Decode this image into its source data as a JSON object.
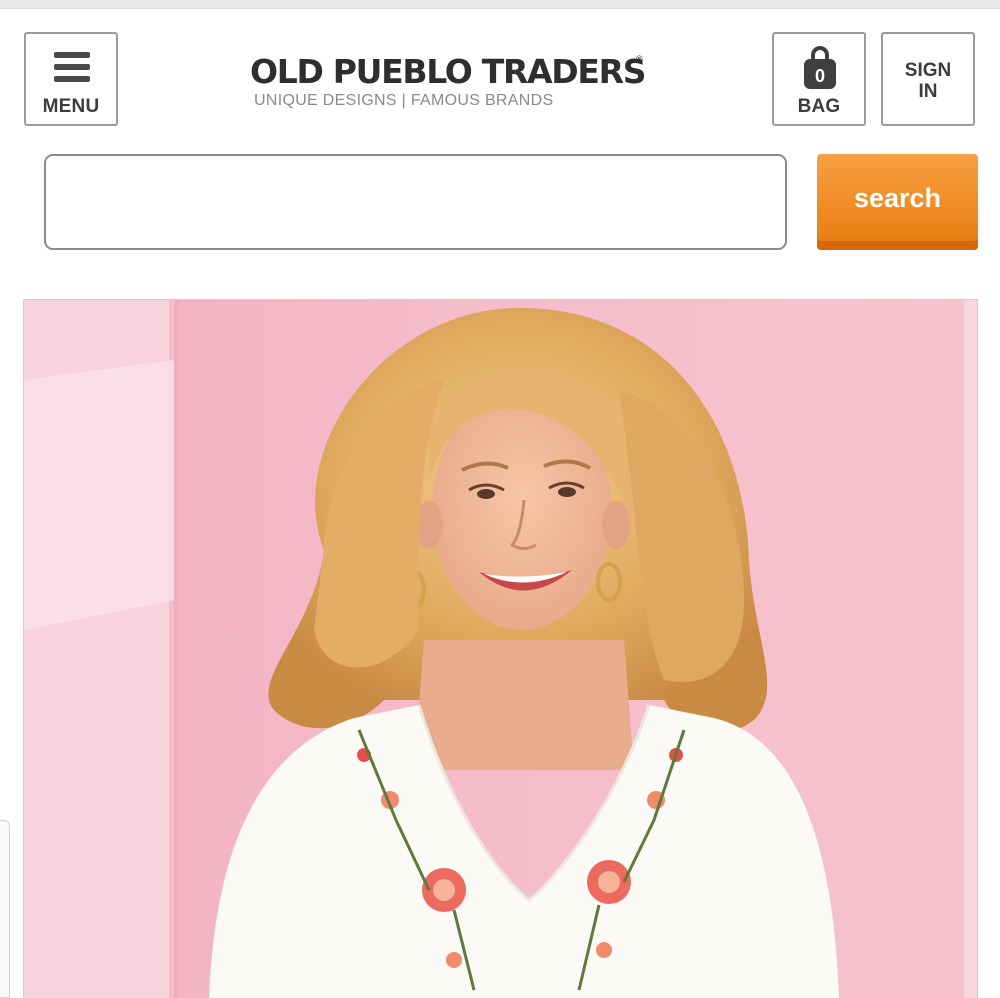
{
  "header": {
    "menu_label": "MENU",
    "bag_label": "BAG",
    "bag_count": "0",
    "signin_line1": "SIGN",
    "signin_line2": "IN",
    "logo_title": "OLD PUEBLO TRADERS",
    "logo_reg": "®",
    "logo_tagline": "UNIQUE DESIGNS | FAMOUS BRANDS"
  },
  "search": {
    "input_value": "",
    "placeholder": "",
    "button_label": "search"
  },
  "colors": {
    "accent_orange": "#f08a22",
    "hero_background": "#f6bfcd",
    "text_dark": "#3d3d3d"
  },
  "icons": {
    "menu": "hamburger-icon",
    "bag": "shopping-bag-icon"
  }
}
